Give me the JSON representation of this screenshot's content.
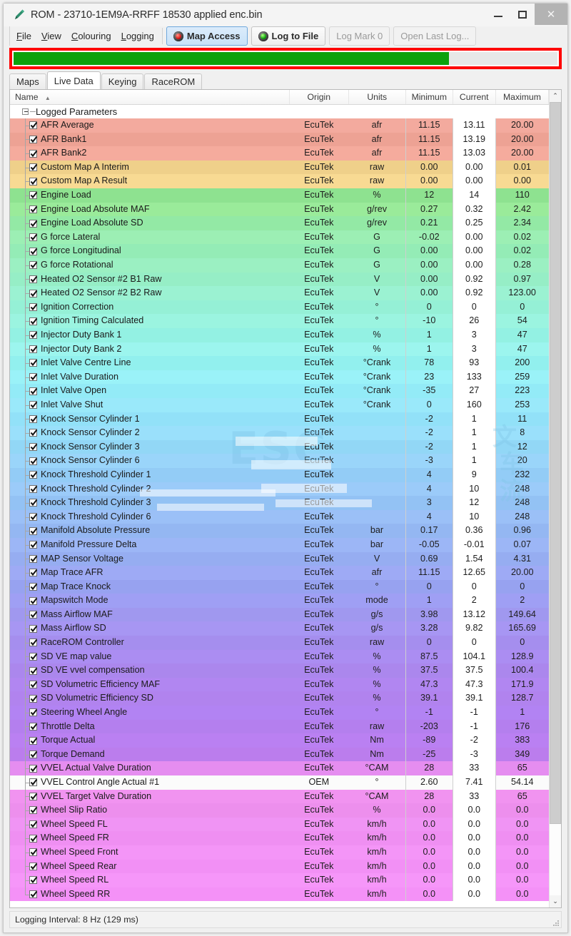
{
  "window": {
    "title": "ROM - 23710-1EM9A-RRFF 18530 applied enc.bin",
    "title_icon": "tuning-pen-icon",
    "minimize_label": "–",
    "maximize_label": "❑",
    "close_label": "✕"
  },
  "menu": {
    "items": [
      {
        "label": "File",
        "accel": "F"
      },
      {
        "label": "View",
        "accel": "V"
      },
      {
        "label": "Colouring",
        "accel": "C"
      },
      {
        "label": "Logging",
        "accel": "L"
      }
    ]
  },
  "toolbar": {
    "buttons": [
      {
        "label": "Map Access",
        "icon": "led-red-icon",
        "state": "active",
        "led": "red"
      },
      {
        "label": "Log to File",
        "icon": "led-green-icon",
        "state": "normal",
        "led": "green"
      },
      {
        "label": "Log Mark 0",
        "icon": "",
        "state": "disabled",
        "led": ""
      },
      {
        "label": "Open Last Log...",
        "icon": "",
        "state": "disabled",
        "led": ""
      }
    ]
  },
  "progress": {
    "percent": 80,
    "fill_color": "#0ca10c",
    "border_color": "#fe0000"
  },
  "tabs": [
    {
      "label": "Maps",
      "active": false
    },
    {
      "label": "Live Data",
      "active": true
    },
    {
      "label": "Keying",
      "active": false
    },
    {
      "label": "RaceROM",
      "active": false
    }
  ],
  "table": {
    "columns": [
      {
        "key": "name",
        "label": "Name",
        "sort": "asc"
      },
      {
        "key": "origin",
        "label": "Origin",
        "sort": ""
      },
      {
        "key": "units",
        "label": "Units",
        "sort": ""
      },
      {
        "key": "min",
        "label": "Minimum",
        "sort": ""
      },
      {
        "key": "cur",
        "label": "Current",
        "sort": ""
      },
      {
        "key": "max",
        "label": "Maximum",
        "sort": ""
      }
    ],
    "sort_indicator": "▲",
    "group_label": "Logged Parameters",
    "rows": [
      {
        "name": "AFR Average",
        "origin": "EcuTek",
        "units": "afr",
        "min": "11.15",
        "cur": "13.11",
        "max": "20.00",
        "checked": true,
        "color": "#f3aa9e"
      },
      {
        "name": "AFR Bank1",
        "origin": "EcuTek",
        "units": "afr",
        "min": "11.15",
        "cur": "13.19",
        "max": "20.00",
        "checked": true,
        "color": "#eda294"
      },
      {
        "name": "AFR Bank2",
        "origin": "EcuTek",
        "units": "afr",
        "min": "11.15",
        "cur": "13.03",
        "max": "20.00",
        "checked": true,
        "color": "#f5ab9d"
      },
      {
        "name": "Custom Map A Interim",
        "origin": "EcuTek",
        "units": "raw",
        "min": "0.00",
        "cur": "0.00",
        "max": "0.01",
        "checked": true,
        "color": "#efd08a"
      },
      {
        "name": "Custom Map A Result",
        "origin": "EcuTek",
        "units": "raw",
        "min": "0.00",
        "cur": "0.00",
        "max": "0.00",
        "checked": true,
        "color": "#f8da93"
      },
      {
        "name": "Engine Load",
        "origin": "EcuTek",
        "units": "%",
        "min": "12",
        "cur": "14",
        "max": "110",
        "checked": true,
        "color": "#8ee290"
      },
      {
        "name": "Engine Load Absolute MAF",
        "origin": "EcuTek",
        "units": "g/rev",
        "min": "0.27",
        "cur": "0.32",
        "max": "2.42",
        "checked": true,
        "color": "#9aeb9a"
      },
      {
        "name": "Engine Load Absolute SD",
        "origin": "EcuTek",
        "units": "g/rev",
        "min": "0.21",
        "cur": "0.25",
        "max": "2.34",
        "checked": true,
        "color": "#93e9a5"
      },
      {
        "name": "G force Lateral",
        "origin": "EcuTek",
        "units": "G",
        "min": "-0.02",
        "cur": "0.00",
        "max": "0.02",
        "checked": true,
        "color": "#9cefb4"
      },
      {
        "name": "G force Longitudinal",
        "origin": "EcuTek",
        "units": "G",
        "min": "0.00",
        "cur": "0.00",
        "max": "0.02",
        "checked": true,
        "color": "#94ecb6"
      },
      {
        "name": "G force Rotational",
        "origin": "EcuTek",
        "units": "G",
        "min": "0.00",
        "cur": "0.00",
        "max": "0.28",
        "checked": true,
        "color": "#9bf0c2"
      },
      {
        "name": "Heated O2 Sensor #2 B1 Raw",
        "origin": "EcuTek",
        "units": "V",
        "min": "0.00",
        "cur": "0.92",
        "max": "0.97",
        "checked": true,
        "color": "#96eec6"
      },
      {
        "name": "Heated O2 Sensor #2 B2 Raw",
        "origin": "EcuTek",
        "units": "V",
        "min": "0.00",
        "cur": "0.92",
        "max": "123.00",
        "checked": true,
        "color": "#9bf2d2"
      },
      {
        "name": "Ignition Correction",
        "origin": "EcuTek",
        "units": "°",
        "min": "0",
        "cur": "0",
        "max": "0",
        "checked": true,
        "color": "#95f0d6"
      },
      {
        "name": "Ignition Timing Calculated",
        "origin": "EcuTek",
        "units": "°",
        "min": "-10",
        "cur": "26",
        "max": "54",
        "checked": true,
        "color": "#9bf4e0"
      },
      {
        "name": "Injector Duty Bank 1",
        "origin": "EcuTek",
        "units": "%",
        "min": "1",
        "cur": "3",
        "max": "47",
        "checked": true,
        "color": "#93f1e3"
      },
      {
        "name": "Injector Duty Bank 2",
        "origin": "EcuTek",
        "units": "%",
        "min": "1",
        "cur": "3",
        "max": "47",
        "checked": true,
        "color": "#9cf5ee"
      },
      {
        "name": "Inlet Valve Centre Line",
        "origin": "EcuTek",
        "units": "°Crank",
        "min": "78",
        "cur": "93",
        "max": "200",
        "checked": true,
        "color": "#92f0ee"
      },
      {
        "name": "Inlet Valve Duration",
        "origin": "EcuTek",
        "units": "°Crank",
        "min": "23",
        "cur": "133",
        "max": "259",
        "checked": true,
        "color": "#9af2f8"
      },
      {
        "name": "Inlet Valve Open",
        "origin": "EcuTek",
        "units": "°Crank",
        "min": "-35",
        "cur": "27",
        "max": "223",
        "checked": true,
        "color": "#93ebf7"
      },
      {
        "name": "Inlet Valve Shut",
        "origin": "EcuTek",
        "units": "°Crank",
        "min": "0",
        "cur": "160",
        "max": "253",
        "checked": true,
        "color": "#9ae9fa"
      },
      {
        "name": "Knock Sensor Cylinder 1",
        "origin": "EcuTek",
        "units": "",
        "min": "-2",
        "cur": "1",
        "max": "11",
        "checked": true,
        "color": "#92e1f8"
      },
      {
        "name": "Knock Sensor Cylinder 2",
        "origin": "EcuTek",
        "units": "",
        "min": "-2",
        "cur": "1",
        "max": "8",
        "checked": true,
        "color": "#9ae0fb"
      },
      {
        "name": "Knock Sensor Cylinder 3",
        "origin": "EcuTek",
        "units": "",
        "min": "-2",
        "cur": "1",
        "max": "12",
        "checked": true,
        "color": "#92d7f6"
      },
      {
        "name": "Knock Sensor Cylinder 6",
        "origin": "EcuTek",
        "units": "",
        "min": "-3",
        "cur": "1",
        "max": "20",
        "checked": true,
        "color": "#9ad5fa"
      },
      {
        "name": "Knock Threshold Cylinder 1",
        "origin": "EcuTek",
        "units": "",
        "min": "4",
        "cur": "9",
        "max": "232",
        "checked": true,
        "color": "#93ccf6"
      },
      {
        "name": "Knock Threshold Cylinder 2",
        "origin": "EcuTek",
        "units": "",
        "min": "4",
        "cur": "10",
        "max": "248",
        "checked": true,
        "color": "#9bcbf9"
      },
      {
        "name": "Knock Threshold Cylinder 3",
        "origin": "EcuTek",
        "units": "",
        "min": "3",
        "cur": "12",
        "max": "248",
        "checked": true,
        "color": "#93c2f4"
      },
      {
        "name": "Knock Threshold Cylinder 6",
        "origin": "EcuTek",
        "units": "",
        "min": "4",
        "cur": "10",
        "max": "248",
        "checked": true,
        "color": "#9bc0f7"
      },
      {
        "name": "Manifold Absolute Pressure",
        "origin": "EcuTek",
        "units": "bar",
        "min": "0.17",
        "cur": "0.36",
        "max": "0.96",
        "checked": true,
        "color": "#94b7f2"
      },
      {
        "name": "Manifold Pressure Delta",
        "origin": "EcuTek",
        "units": "bar",
        "min": "-0.05",
        "cur": "-0.01",
        "max": "0.07",
        "checked": true,
        "color": "#9cb6f6"
      },
      {
        "name": "MAP Sensor Voltage",
        "origin": "EcuTek",
        "units": "V",
        "min": "0.69",
        "cur": "1.54",
        "max": "4.31",
        "checked": true,
        "color": "#96adf1"
      },
      {
        "name": "Map Trace AFR",
        "origin": "EcuTek",
        "units": "afr",
        "min": "11.15",
        "cur": "12.65",
        "max": "20.00",
        "checked": true,
        "color": "#9eaaf5"
      },
      {
        "name": "Map Trace Knock",
        "origin": "EcuTek",
        "units": "°",
        "min": "0",
        "cur": "0",
        "max": "0",
        "checked": true,
        "color": "#97a2f0"
      },
      {
        "name": "Mapswitch Mode",
        "origin": "EcuTek",
        "units": "mode",
        "min": "1",
        "cur": "2",
        "max": "2",
        "checked": true,
        "color": "#9f9ff4"
      },
      {
        "name": "Mass Airflow MAF",
        "origin": "EcuTek",
        "units": "g/s",
        "min": "3.98",
        "cur": "13.12",
        "max": "149.64",
        "checked": true,
        "color": "#a098ef"
      },
      {
        "name": "Mass Airflow SD",
        "origin": "EcuTek",
        "units": "g/s",
        "min": "3.28",
        "cur": "9.82",
        "max": "165.69",
        "checked": true,
        "color": "#a796f3"
      },
      {
        "name": "RaceROM Controller",
        "origin": "EcuTek",
        "units": "raw",
        "min": "0",
        "cur": "0",
        "max": "0",
        "checked": true,
        "color": "#a58eee"
      },
      {
        "name": "SD VE map value",
        "origin": "EcuTek",
        "units": "%",
        "min": "87.5",
        "cur": "104.1",
        "max": "128.9",
        "checked": true,
        "color": "#ab8df2"
      },
      {
        "name": "SD VE vvel compensation",
        "origin": "EcuTek",
        "units": "%",
        "min": "37.5",
        "cur": "37.5",
        "max": "100.4",
        "checked": true,
        "color": "#ab87ed"
      },
      {
        "name": "SD Volumetric Efficiency MAF",
        "origin": "EcuTek",
        "units": "%",
        "min": "47.3",
        "cur": "47.3",
        "max": "171.9",
        "checked": true,
        "color": "#b186f1"
      },
      {
        "name": "SD Volumetric Efficiency SD",
        "origin": "EcuTek",
        "units": "%",
        "min": "39.1",
        "cur": "39.1",
        "max": "128.7",
        "checked": true,
        "color": "#b183ee"
      },
      {
        "name": "Steering Wheel Angle",
        "origin": "EcuTek",
        "units": "°",
        "min": "-1",
        "cur": "-1",
        "max": "1",
        "checked": true,
        "color": "#b283f3"
      },
      {
        "name": "Throttle Delta",
        "origin": "EcuTek",
        "units": "raw",
        "min": "-203",
        "cur": "-1",
        "max": "176",
        "checked": true,
        "color": "#b47fee"
      },
      {
        "name": "Torque Actual",
        "origin": "EcuTek",
        "units": "Nm",
        "min": "-89",
        "cur": "-2",
        "max": "383",
        "checked": true,
        "color": "#ba80f2"
      },
      {
        "name": "Torque Demand",
        "origin": "EcuTek",
        "units": "Nm",
        "min": "-25",
        "cur": "-3",
        "max": "349",
        "checked": true,
        "color": "#bb7ded"
      },
      {
        "name": "VVEL Actual Valve Duration",
        "origin": "EcuTek",
        "units": "°CAM",
        "min": "28",
        "cur": "33",
        "max": "65",
        "checked": true,
        "color": "#e58df0"
      },
      {
        "name": "VVEL Control Angle Actual #1",
        "origin": "OEM",
        "units": "°",
        "min": "2.60",
        "cur": "7.41",
        "max": "54.14",
        "checked": true,
        "color": "#fbfbfb",
        "selected": true
      },
      {
        "name": "VVEL Target Valve Duration",
        "origin": "EcuTek",
        "units": "°CAM",
        "min": "28",
        "cur": "33",
        "max": "65",
        "checked": true,
        "color": "#f193f0"
      },
      {
        "name": "Wheel Slip Ratio",
        "origin": "EcuTek",
        "units": "%",
        "min": "0.0",
        "cur": "0.0",
        "max": "0.0",
        "checked": true,
        "color": "#ed8fed"
      },
      {
        "name": "Wheel Speed FL",
        "origin": "EcuTek",
        "units": "km/h",
        "min": "0.0",
        "cur": "0.0",
        "max": "0.0",
        "checked": true,
        "color": "#f094f4"
      },
      {
        "name": "Wheel Speed FR",
        "origin": "EcuTek",
        "units": "km/h",
        "min": "0.0",
        "cur": "0.0",
        "max": "0.0",
        "checked": true,
        "color": "#ef8ff2"
      },
      {
        "name": "Wheel Speed Front",
        "origin": "EcuTek",
        "units": "km/h",
        "min": "0.0",
        "cur": "0.0",
        "max": "0.0",
        "checked": true,
        "color": "#f495f7"
      },
      {
        "name": "Wheel Speed Rear",
        "origin": "EcuTek",
        "units": "km/h",
        "min": "0.0",
        "cur": "0.0",
        "max": "0.0",
        "checked": true,
        "color": "#f290f5"
      },
      {
        "name": "Wheel Speed RL",
        "origin": "EcuTek",
        "units": "km/h",
        "min": "0.0",
        "cur": "0.0",
        "max": "0.0",
        "checked": true,
        "color": "#f696f9"
      },
      {
        "name": "Wheel Speed RR",
        "origin": "EcuTek",
        "units": "km/h",
        "min": "0.0",
        "cur": "0.0",
        "max": "0.0",
        "checked": true,
        "color": "#f491f7"
      }
    ]
  },
  "scrollbar": {
    "up_arrow": "⌃",
    "down_arrow": "⌄",
    "thumb_percent": 91
  },
  "statusbar": {
    "text": "Logging Interval: 8 Hz (129 ms)"
  },
  "watermark": {
    "glyph_text": "ESC",
    "cjk_top": "文",
    "cjk_mid": "车",
    "cjk_bot": "流"
  }
}
